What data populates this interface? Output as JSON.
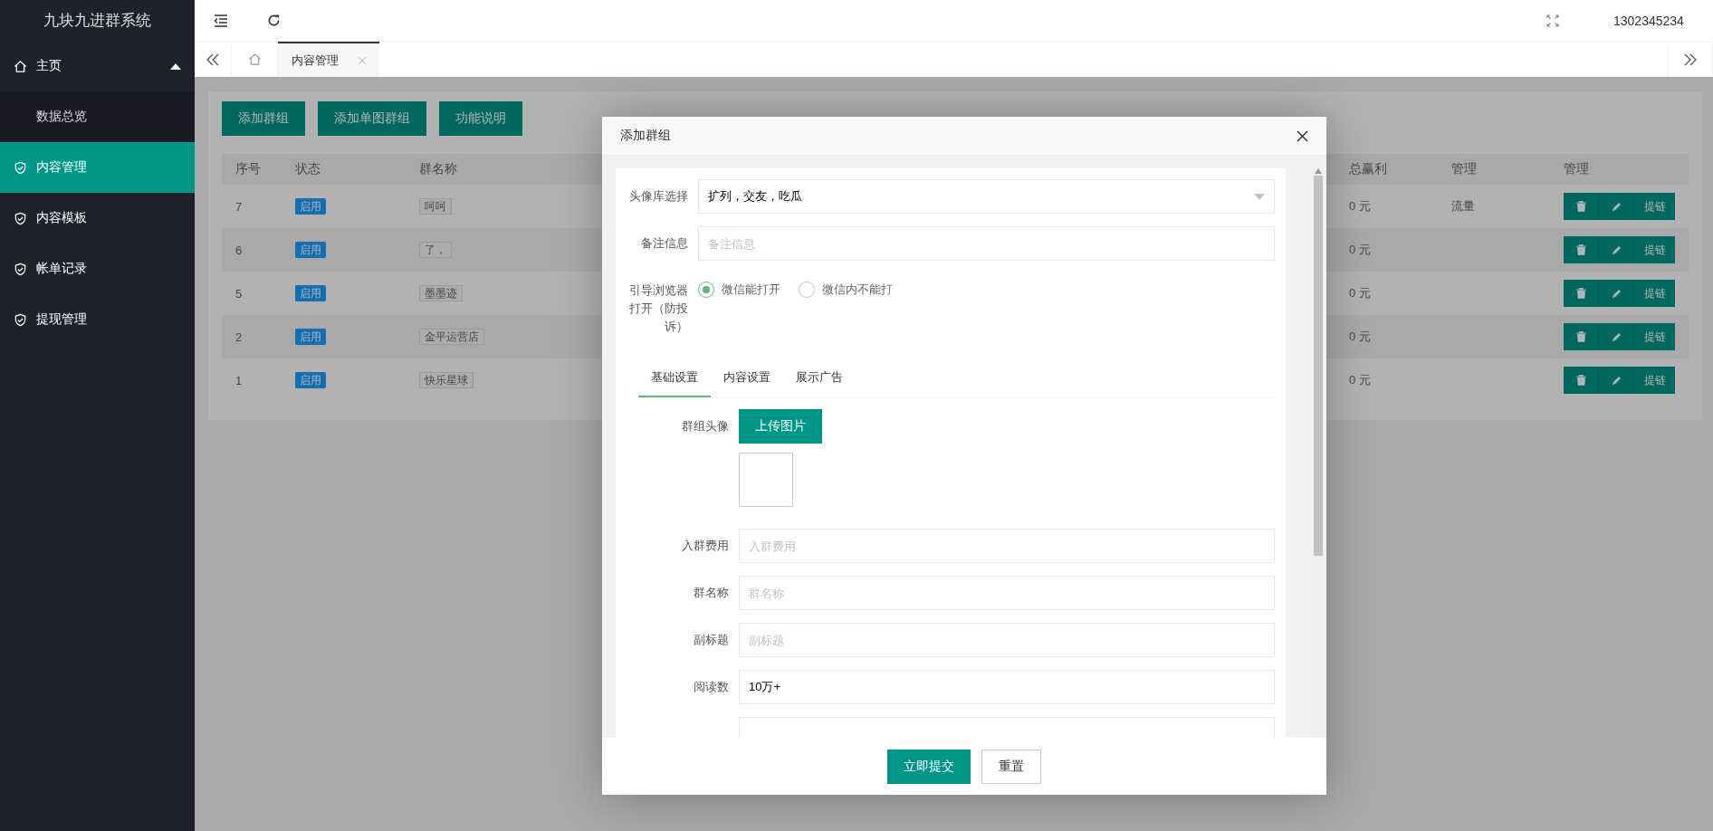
{
  "sidebar": {
    "title": "九块九进群系统",
    "items": [
      {
        "label": "主页",
        "expanded": true,
        "selected": false,
        "children": [
          {
            "label": "数据总览",
            "selected": false
          }
        ]
      },
      {
        "label": "内容管理",
        "selected": true
      },
      {
        "label": "内容模板",
        "selected": false
      },
      {
        "label": "帐单记录",
        "selected": false
      },
      {
        "label": "提现管理",
        "selected": false
      }
    ]
  },
  "header": {
    "user": "1302345234"
  },
  "tabs": [
    {
      "label": "内容管理",
      "selected": true
    }
  ],
  "toolbar": [
    "添加群组",
    "添加单图群组",
    "功能说明"
  ],
  "table": {
    "columns": [
      "序号",
      "状态",
      "群名称",
      "总赢利",
      "管理",
      "管理"
    ],
    "rows": [
      {
        "id": "7",
        "status": "启用",
        "name": "呵呵",
        "profit": "0 元",
        "manage": "流量",
        "link": "提链"
      },
      {
        "id": "6",
        "status": "启用",
        "name": "了，",
        "profit": "0 元",
        "link": "提链"
      },
      {
        "id": "5",
        "status": "启用",
        "name": "墨墨迹",
        "profit": "0 元",
        "link": "提链"
      },
      {
        "id": "2",
        "status": "启用",
        "name": "金平运营店",
        "profit": "0 元",
        "link": "提链"
      },
      {
        "id": "1",
        "status": "启用",
        "name": "快乐星球",
        "profit": "0 元",
        "link": "提链"
      }
    ]
  },
  "dialog": {
    "title": "添加群组",
    "fields": [
      {
        "kind": "select",
        "label": "头像库选择",
        "value": "扩列，交友，吃瓜"
      },
      {
        "kind": "input",
        "label": "备注信息",
        "placeholder": "备注信息"
      },
      {
        "kind": "radio",
        "label": "引导浏览器打开（防投诉）",
        "options": [
          {
            "label": "微信能打开",
            "selected": true
          },
          {
            "label": "微信内不能打",
            "selected": false
          }
        ]
      }
    ],
    "tabs": [
      {
        "label": "基础设置",
        "selected": true
      },
      {
        "label": "内容设置",
        "selected": false
      },
      {
        "label": "展示广告",
        "selected": false
      }
    ],
    "tab_fields": [
      {
        "kind": "upload",
        "label": "群组头像",
        "button": "上传图片"
      },
      {
        "kind": "input",
        "label": "入群费用",
        "placeholder": "入群费用"
      },
      {
        "kind": "input",
        "label": "群名称",
        "placeholder": "群名称"
      },
      {
        "kind": "input",
        "label": "副标题",
        "placeholder": "副标题"
      },
      {
        "kind": "input",
        "label": "阅读数",
        "value": "10万+"
      },
      {
        "kind": "input"
      }
    ],
    "buttons": [
      {
        "label": "立即提交",
        "kind": "primary"
      },
      {
        "label": "重置",
        "kind": "plain"
      }
    ]
  }
}
